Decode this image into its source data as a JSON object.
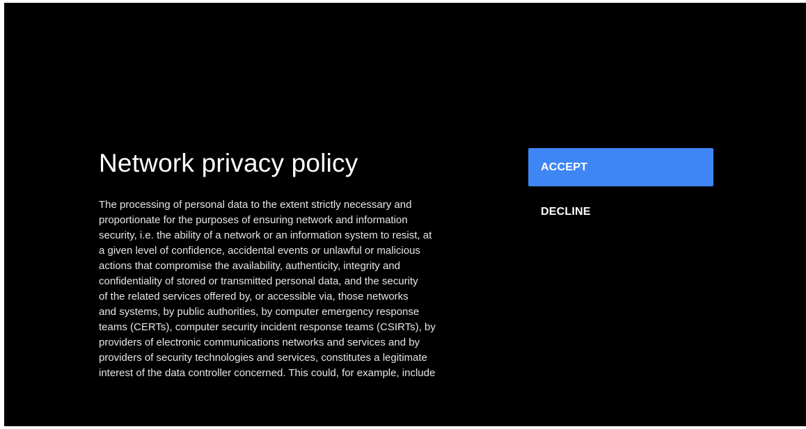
{
  "dialog": {
    "title": "Network privacy policy",
    "body_lines": [
      "The processing of personal data to the extent strictly necessary and",
      "proportionate for the purposes of ensuring network and information",
      "security, i.e. the ability of a network or an information system to resist, at",
      "a given level of confidence, accidental events or unlawful or malicious",
      "actions that compromise the availability, authenticity, integrity and",
      "confidentiality of stored or transmitted personal data, and the security",
      "of the related services offered by, or accessible via, those networks",
      "and systems, by public authorities, by computer emergency response",
      "teams (CERTs), computer security incident response teams (CSIRTs), by",
      "providers of electronic communications networks and services and by",
      "providers of security technologies and services, constitutes a legitimate",
      "interest of the data controller concerned. This could, for example, include"
    ]
  },
  "actions": {
    "accept_label": "ACCEPT",
    "decline_label": "DECLINE"
  },
  "colors": {
    "background": "#000000",
    "accent": "#3f86f5",
    "text": "#ffffff"
  }
}
